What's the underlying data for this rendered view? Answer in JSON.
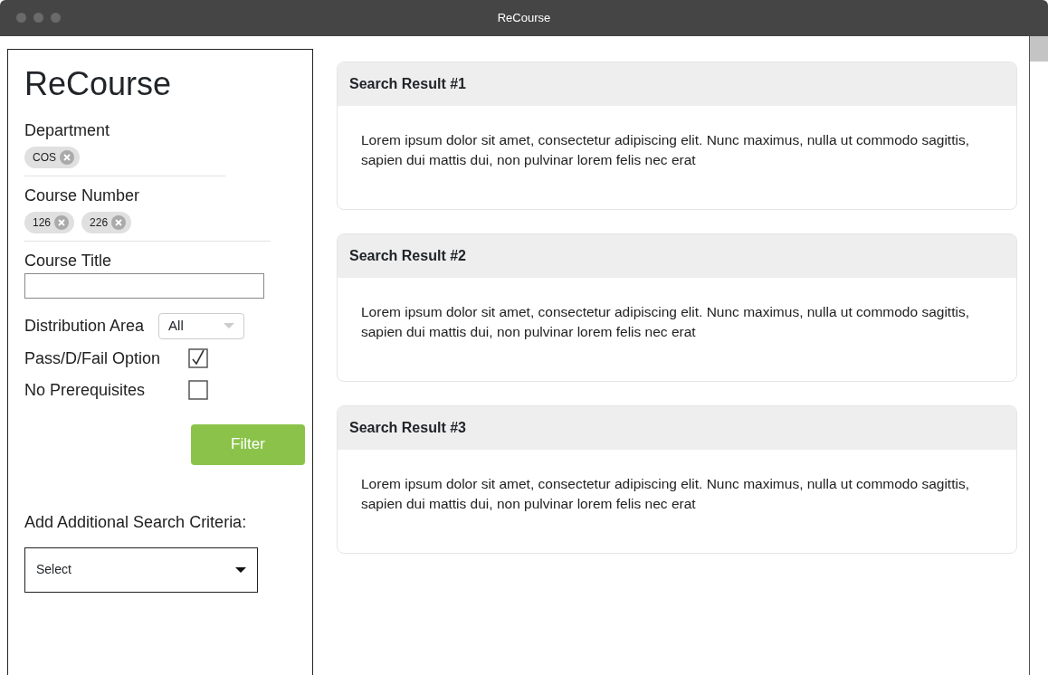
{
  "window": {
    "title": "ReCourse"
  },
  "sidebar": {
    "heading": "ReCourse",
    "tag_groups": [
      {
        "label": "Department",
        "tags": [
          "COS"
        ]
      },
      {
        "label": "Course Number",
        "tags": [
          "126",
          "226"
        ]
      }
    ],
    "course_title": {
      "label": "Course Title"
    },
    "distribution_area": {
      "label": "Distribution Area",
      "value": "All"
    },
    "options": [
      {
        "label": "Pass/D/Fail Option",
        "checked": true
      },
      {
        "label": "No Prerequisites",
        "checked": false
      }
    ],
    "filter_button": "Filter",
    "additional": {
      "label": "Add Additional Search Criteria:",
      "value": "Select"
    }
  },
  "results": [
    {
      "title": "Search Result #1",
      "body": "Lorem ipsum dolor sit amet, consectetur adipiscing elit. Nunc maximus, nulla ut commodo sagittis, sapien dui mattis dui, non pulvinar lorem felis nec erat"
    },
    {
      "title": "Search Result #2",
      "body": "Lorem ipsum dolor sit amet, consectetur adipiscing elit. Nunc maximus, nulla ut commodo sagittis, sapien dui mattis dui, non pulvinar lorem felis nec erat"
    },
    {
      "title": "Search Result #3",
      "body": "Lorem ipsum dolor sit amet, consectetur adipiscing elit. Nunc maximus, nulla ut commodo sagittis, sapien dui mattis dui, non pulvinar lorem felis nec erat"
    }
  ]
}
